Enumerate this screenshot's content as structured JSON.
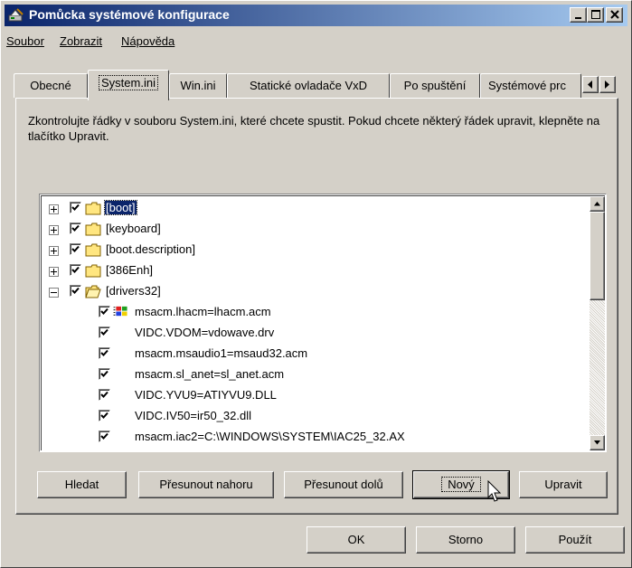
{
  "window": {
    "title": "Pomůcka systémové konfigurace",
    "app_icon": "msconfig-icon"
  },
  "menu": [
    "Soubor",
    "Zobrazit",
    "Nápověda"
  ],
  "tabs": [
    "Obecné",
    "System.ini",
    "Win.ini",
    "Statické ovladače VxD",
    "Po spuštění",
    "Systémové prc"
  ],
  "active_tab": "System.ini",
  "instructions": "Zkontrolujte řádky v souboru System.ini, které chcete spustit. Pokud chcete některý řádek upravit, klepněte na tlačítko Upravit.",
  "tree": {
    "sections": [
      {
        "label": "[boot]",
        "checked": true,
        "expanded": false,
        "selected": true
      },
      {
        "label": "[keyboard]",
        "checked": true,
        "expanded": false
      },
      {
        "label": "[boot.description]",
        "checked": true,
        "expanded": false
      },
      {
        "label": "[386Enh]",
        "checked": true,
        "expanded": false
      },
      {
        "label": "[drivers32]",
        "checked": true,
        "expanded": true
      }
    ],
    "entries": [
      {
        "label": "msacm.lhacm=lhacm.acm",
        "checked": true,
        "icon": "windows-flag-icon"
      },
      {
        "label": "VIDC.VDOM=vdowave.drv",
        "checked": true
      },
      {
        "label": "msacm.msaudio1=msaud32.acm",
        "checked": true
      },
      {
        "label": "msacm.sl_anet=sl_anet.acm",
        "checked": true
      },
      {
        "label": "VIDC.YVU9=ATIYVU9.DLL",
        "checked": true
      },
      {
        "label": "VIDC.IV50=ir50_32.dll",
        "checked": true
      },
      {
        "label": "msacm.iac2=C:\\WINDOWS\\SYSTEM\\IAC25_32.AX",
        "checked": true
      }
    ]
  },
  "buttons": {
    "find": "Hledat",
    "move_up": "Přesunout nahoru",
    "move_down": "Přesunout dolů",
    "new": "Nový",
    "edit": "Upravit",
    "ok": "OK",
    "cancel": "Storno",
    "apply": "Použít"
  }
}
